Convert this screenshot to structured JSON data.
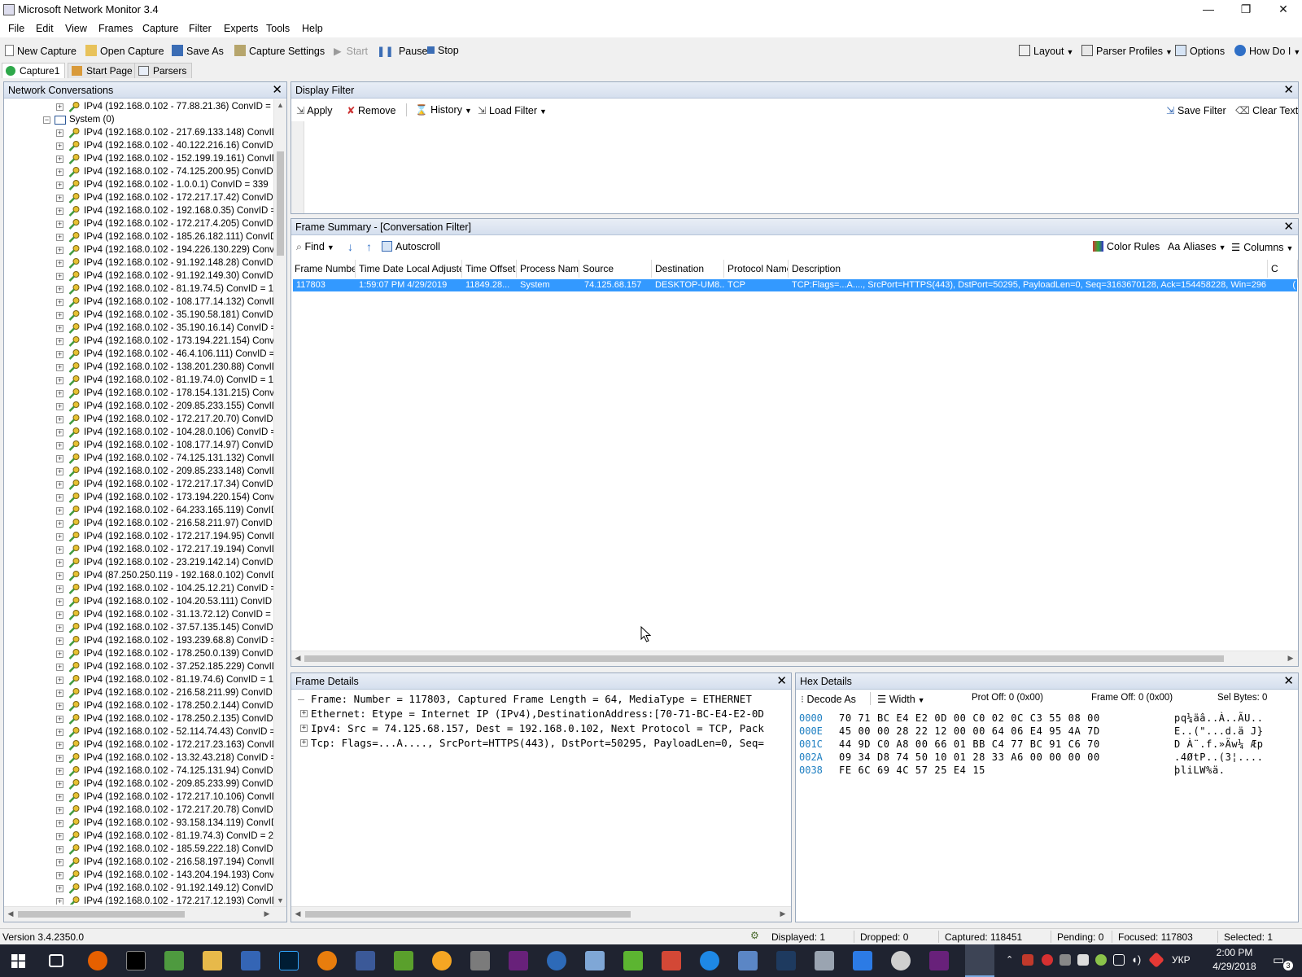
{
  "window": {
    "title": "Microsoft Network Monitor 3.4",
    "minimize": "—",
    "maximize": "❐",
    "close": "✕"
  },
  "menu": [
    "File",
    "Edit",
    "View",
    "Frames",
    "Capture",
    "Filter",
    "Experts",
    "Tools",
    "Help"
  ],
  "toolbar": {
    "new_capture": "New Capture",
    "open_capture": "Open Capture",
    "save_as": "Save As",
    "capture_settings": "Capture Settings",
    "start": "Start",
    "pause": "Pause",
    "stop": "Stop",
    "layout": "Layout",
    "parser_profiles": "Parser Profiles",
    "options": "Options",
    "how_do_i": "How Do I"
  },
  "tabs": {
    "capture1": "Capture1",
    "start_page": "Start Page",
    "parsers": "Parsers"
  },
  "conversations": {
    "title": "Network Conversations",
    "top_row": "IPv4 (192.168.0.102 - 77.88.21.36) ConvID = 8",
    "group": "System (0)",
    "rows": [
      "IPv4 (192.168.0.102 - 217.69.133.148) ConvID",
      "IPv4 (192.168.0.102 - 40.122.216.16) ConvID",
      "IPv4 (192.168.0.102 - 152.199.19.161) ConvID",
      "IPv4 (192.168.0.102 - 74.125.200.95) ConvID",
      "IPv4 (192.168.0.102 - 1.0.0.1) ConvID = 339",
      "IPv4 (192.168.0.102 - 172.217.17.42) ConvID",
      "IPv4 (192.168.0.102 - 192.168.0.35) ConvID =",
      "IPv4 (192.168.0.102 - 172.217.4.205) ConvID",
      "IPv4 (192.168.0.102 - 185.26.182.111) ConvID",
      "IPv4 (192.168.0.102 - 194.226.130.229) ConvI",
      "IPv4 (192.168.0.102 - 91.192.148.28) ConvID",
      "IPv4 (192.168.0.102 - 91.192.149.30) ConvID",
      "IPv4 (192.168.0.102 - 81.19.74.5) ConvID = 1",
      "IPv4 (192.168.0.102 - 108.177.14.132) ConvID",
      "IPv4 (192.168.0.102 - 35.190.58.181) ConvID",
      "IPv4 (192.168.0.102 - 35.190.16.14) ConvID =",
      "IPv4 (192.168.0.102 - 173.194.221.154) ConvI",
      "IPv4 (192.168.0.102 - 46.4.106.111) ConvID =",
      "IPv4 (192.168.0.102 - 138.201.230.88) ConvID",
      "IPv4 (192.168.0.102 - 81.19.74.0) ConvID = 1",
      "IPv4 (192.168.0.102 - 178.154.131.215) ConvI",
      "IPv4 (192.168.0.102 - 209.85.233.155) ConvID",
      "IPv4 (192.168.0.102 - 172.217.20.70) ConvID",
      "IPv4 (192.168.0.102 - 104.28.0.106) ConvID =",
      "IPv4 (192.168.0.102 - 108.177.14.97) ConvID",
      "IPv4 (192.168.0.102 - 74.125.131.132) ConvID",
      "IPv4 (192.168.0.102 - 209.85.233.148) ConvID",
      "IPv4 (192.168.0.102 - 172.217.17.34) ConvID",
      "IPv4 (192.168.0.102 - 173.194.220.154) ConvI",
      "IPv4 (192.168.0.102 - 64.233.165.119) ConvID",
      "IPv4 (192.168.0.102 - 216.58.211.97) ConvID",
      "IPv4 (192.168.0.102 - 172.217.194.95) ConvID",
      "IPv4 (192.168.0.102 - 172.217.19.194) ConvID",
      "IPv4 (192.168.0.102 - 23.219.142.14) ConvID",
      "IPv4 (87.250.250.119 - 192.168.0.102) ConvID",
      "IPv4 (192.168.0.102 - 104.25.12.21) ConvID =",
      "IPv4 (192.168.0.102 - 104.20.53.111) ConvID",
      "IPv4 (192.168.0.102 - 31.13.72.12) ConvID = 2",
      "IPv4 (192.168.0.102 - 37.57.135.145) ConvID",
      "IPv4 (192.168.0.102 - 193.239.68.8) ConvID =",
      "IPv4 (192.168.0.102 - 178.250.0.139) ConvID",
      "IPv4 (192.168.0.102 - 37.252.185.229) ConvID",
      "IPv4 (192.168.0.102 - 81.19.74.6) ConvID = 1",
      "IPv4 (192.168.0.102 - 216.58.211.99) ConvID",
      "IPv4 (192.168.0.102 - 178.250.2.144) ConvID",
      "IPv4 (192.168.0.102 - 178.250.2.135) ConvID",
      "IPv4 (192.168.0.102 - 52.114.74.43) ConvID =",
      "IPv4 (192.168.0.102 - 172.217.23.163) ConvID",
      "IPv4 (192.168.0.102 - 13.32.43.218) ConvID =",
      "IPv4 (192.168.0.102 - 74.125.131.94) ConvID",
      "IPv4 (192.168.0.102 - 209.85.233.99) ConvID",
      "IPv4 (192.168.0.102 - 172.217.10.106) ConvID",
      "IPv4 (192.168.0.102 - 172.217.20.78) ConvID",
      "IPv4 (192.168.0.102 - 93.158.134.119) ConvID",
      "IPv4 (192.168.0.102 - 81.19.74.3) ConvID = 2",
      "IPv4 (192.168.0.102 - 185.59.222.18) ConvID",
      "IPv4 (192.168.0.102 - 216.58.197.194) ConvID",
      "IPv4 (192.168.0.102 - 143.204.194.193) ConvI",
      "IPv4 (192.168.0.102 - 91.192.149.12) ConvID",
      "IPv4 (192.168.0.102 - 172.217.12.193) ConvID"
    ]
  },
  "display_filter": {
    "title": "Display Filter",
    "apply": "Apply",
    "remove": "Remove",
    "history": "History",
    "load_filter": "Load Filter",
    "save_filter": "Save Filter",
    "clear_text": "Clear Text",
    "text": ""
  },
  "frame_summary": {
    "title": "Frame Summary - [Conversation Filter]",
    "find": "Find",
    "autoscroll": "Autoscroll",
    "color_rules": "Color Rules",
    "aliases": "Aliases",
    "columns": "Columns",
    "headers": [
      "Frame Number",
      "Time Date Local Adjusted",
      "Time Offset",
      "Process Name",
      "Source",
      "Destination",
      "Protocol Name",
      "Description",
      "C"
    ],
    "rows": [
      [
        "117803",
        "1:59:07 PM 4/29/2019",
        "11849.28...",
        "System",
        "74.125.68.157",
        "DESKTOP-UM8...",
        "TCP",
        "TCP:Flags=...A...., SrcPort=HTTPS(443), DstPort=50295, PayloadLen=0, Seq=3163670128, Ack=154458228, Win=296",
        "("
      ]
    ]
  },
  "frame_details": {
    "title": "Frame Details",
    "lines": [
      "Frame: Number = 117803, Captured Frame Length = 64, MediaType = ETHERNET",
      "Ethernet: Etype = Internet IP (IPv4),DestinationAddress:[70-71-BC-E4-E2-0D",
      "Ipv4: Src = 74.125.68.157, Dest = 192.168.0.102, Next Protocol = TCP, Pack",
      "Tcp: Flags=...A...., SrcPort=HTTPS(443), DstPort=50295, PayloadLen=0, Seq="
    ]
  },
  "hex_details": {
    "title": "Hex Details",
    "decode_as": "Decode As",
    "width": "Width",
    "prot_off": "Prot Off: 0 (0x00)",
    "frame_off": "Frame Off: 0 (0x00)",
    "sel_bytes": "Sel Bytes: 0",
    "rows": [
      {
        "offset": "0000",
        "hex": "70 71 BC E4 E2 0D 00 C0 02 0C C3 55 08 00",
        "ascii": "pq¼äâ..À..ÃU.."
      },
      {
        "offset": "000E",
        "hex": "45 00 00 28 22 12 00 00 64 06 E4 95 4A 7D",
        "ascii": "E..(\"...d.ä J}"
      },
      {
        "offset": "001C",
        "hex": "44 9D C0 A8 00 66 01 BB C4 77 BC 91 C6 70",
        "ascii": "D À¨.f.»Äw¼ Æp"
      },
      {
        "offset": "002A",
        "hex": "09 34 D8 74 50 10 01 28 33 A6 00 00 00 00",
        "ascii": ".4ØtP..(3¦...."
      },
      {
        "offset": "0038",
        "hex": "FE 6C 69 4C 57 25 E4 15",
        "ascii": "þliLW%ä."
      }
    ]
  },
  "status": {
    "version": "Version 3.4.2350.0",
    "displayed": "Displayed: 1",
    "dropped": "Dropped: 0",
    "captured": "Captured: 118451",
    "pending": "Pending: 0",
    "focused": "Focused: 117803",
    "selected": "Selected: 1"
  },
  "taskbar": {
    "language": "УКР",
    "time": "2:00 PM",
    "date": "4/29/2018",
    "notifications": "3"
  },
  "colors": {
    "selection": "#3399ff",
    "panel_title": "#d5dfee",
    "taskbar": "#1f2330",
    "hex_offset": "#1e7fc2"
  }
}
